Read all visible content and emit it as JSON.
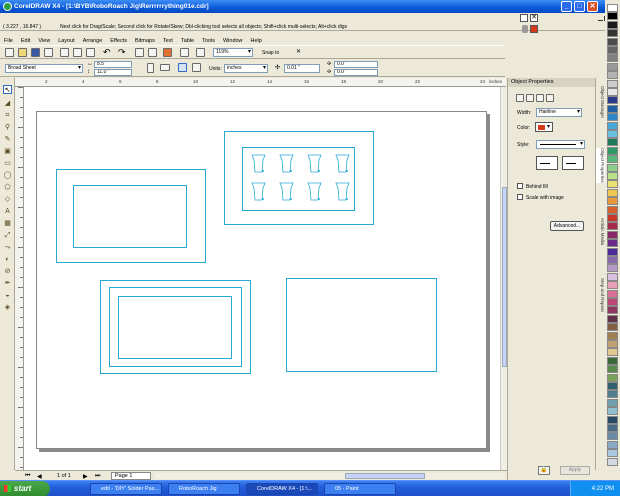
{
  "window": {
    "title": "CorelDRAW X4 - [1:\\BYB\\RoboRoach Jig\\Rerrrrrrything01e.cdr]",
    "minimize_glyph": "_",
    "maximize_glyph": "□",
    "close_glyph": "✕"
  },
  "status": {
    "coords": "( 3.227 , 16.847 )",
    "hint": "Next click for Drag/Scale; Second click for Rotate/Skew; Dbl-clicking tool selects all objects; Shift+click multi-selects; Alt+click digs"
  },
  "menu": [
    "File",
    "Edit",
    "View",
    "Layout",
    "Arrange",
    "Effects",
    "Bitmaps",
    "Text",
    "Table",
    "Tools",
    "Window",
    "Help"
  ],
  "toolbar": {
    "zoom": "119%",
    "snap_to": "Snap to"
  },
  "property_bar": {
    "paper": "Broad Sheet",
    "width": "8.5 \"",
    "height": "11.0 \"",
    "units_label": "Units:",
    "units": "inches",
    "nudge": "0.01 \"",
    "dup_x": "0.0 \"",
    "dup_y": "0.0 \""
  },
  "ruler": {
    "top_ticks": [
      "2",
      "4",
      "6",
      "8",
      "10",
      "12",
      "14",
      "16",
      "18",
      "20",
      "22",
      "24"
    ],
    "top_unit": "inches"
  },
  "document": {
    "page_counter": "1 of 1",
    "page_tab": "Page 1"
  },
  "docker": {
    "title": "Object Properties",
    "width_label": "Width:",
    "width_value": "Hairline",
    "color_label": "Color:",
    "style_label": "Style:",
    "behind_fill": "Behind fill",
    "scale_with_image": "Scale with image",
    "advanced": "Advanced...",
    "apply": "Apply"
  },
  "side_tabs": [
    "Object Manager",
    "Object Properties",
    "Artistic Media",
    "Step and Repeat"
  ],
  "taskbar": {
    "start": "start",
    "tasks": [
      "edit - 'DIY' Solder Pas...",
      "RoboRoach Jig",
      "CorelDRAW X4 - [1:\\...",
      "05 - Paint"
    ],
    "clock": "4:22 PM"
  },
  "colors": {
    "outline": "#27a9d6",
    "outline_swatch": "#d43a1a"
  },
  "palette": [
    "#ffffff",
    "#000000",
    "#1a1a1a",
    "#333333",
    "#4d4d4d",
    "#666666",
    "#808080",
    "#999999",
    "#b3b3b3",
    "#cccccc",
    "#e6e6e6",
    "#2b3a8a",
    "#1f5fa8",
    "#2f86c8",
    "#4aa8d8",
    "#69c0e0",
    "#1f7a5a",
    "#2e9a6a",
    "#58b87a",
    "#8ccf8a",
    "#b9e08a",
    "#e8e070",
    "#f0c850",
    "#e89a3a",
    "#d8602a",
    "#c8382a",
    "#a82a4a",
    "#882a6a",
    "#6a2a8a",
    "#4a2a9a",
    "#8a6aaa",
    "#b89ac8",
    "#d8c0e0",
    "#e8a0b8",
    "#d87098",
    "#c04878",
    "#903860",
    "#603048",
    "#806040",
    "#a08050",
    "#c0a070",
    "#e0c890",
    "#3a6a3a",
    "#5a8a4a",
    "#7aa05a",
    "#306070",
    "#508090",
    "#70a0b0",
    "#90c0d0",
    "#2a4a6a",
    "#4a6a8a",
    "#6a8aaa",
    "#8aaac8",
    "#aac8e0",
    "#d0d8e0"
  ]
}
